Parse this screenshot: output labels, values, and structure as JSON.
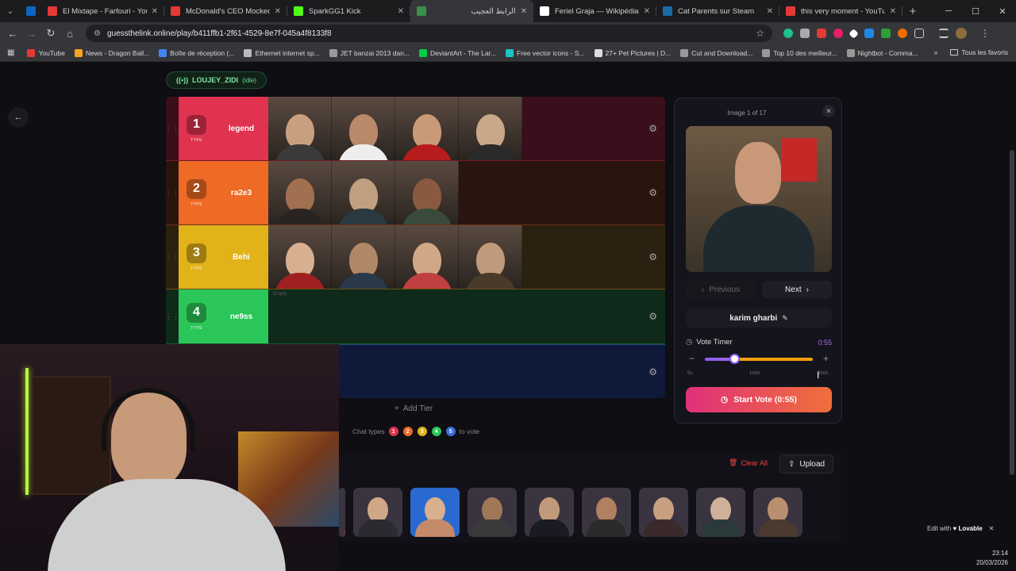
{
  "browser": {
    "tabs": [
      {
        "title": "El Mixtape - Farfouri - YouTube",
        "color": "#e53935"
      },
      {
        "title": "McDonald's CEO Mocked for Bite",
        "color": "#e53935"
      },
      {
        "title": "SparkGG1 Kick",
        "color": "#53fc18"
      },
      {
        "title": "الرابط العجيب",
        "color": "#3a8f4a",
        "active": true
      },
      {
        "title": "Feriel Graja — Wikipédia",
        "color": "#ffffff"
      },
      {
        "title": "Cat Parents sur Steam",
        "color": "#1b6aa5"
      },
      {
        "title": "this very moment - YouTube",
        "color": "#e53935"
      }
    ],
    "url": "guessthelink.online/play/b411ffb1-2f61-4529-8e7f-045a4f8133f8",
    "bookmarks": [
      {
        "label": "YouTube",
        "color": "#e53935"
      },
      {
        "label": "News - Dragon Ball...",
        "color": "#f5a623"
      },
      {
        "label": "Boîte de réception (...",
        "color": "#4285f4"
      },
      {
        "label": "Ethernet internet sp...",
        "color": "#bbbbbb"
      },
      {
        "label": "JET banzai 2013 dan...",
        "color": "#999999"
      },
      {
        "label": "DeviantArt - The Lar...",
        "color": "#05cc47"
      },
      {
        "label": "Free vector icons - S...",
        "color": "#21c4c4"
      },
      {
        "label": "27+ Pet Pictures | D...",
        "color": "#dddddd"
      },
      {
        "label": "Cut and Download...",
        "color": "#999999"
      },
      {
        "label": "Top 10 des meilleur...",
        "color": "#999999"
      },
      {
        "label": "Nightbot - Comma...",
        "color": "#999999"
      }
    ],
    "bookmarks_more": "»",
    "all_bookmarks": "Tous les favoris"
  },
  "app": {
    "user": "LOUJEY_ZIDI",
    "status": "(idle)",
    "type_label": "TYPE",
    "empty_label": "Empty",
    "tiers": [
      {
        "rank": "1",
        "name": "legend",
        "color": "#e0334f",
        "bg": "#3a0e1a",
        "faces": 4
      },
      {
        "rank": "2",
        "name": "ra2e3",
        "color": "#ee6a25",
        "bg": "#2a140e",
        "faces": 3
      },
      {
        "rank": "3",
        "name": "Behi",
        "color": "#e2b21b",
        "bg": "#2a2110",
        "faces": 4
      },
      {
        "rank": "4",
        "name": "ne9ss",
        "color": "#2bc65a",
        "bg": "#0f2a1a",
        "faces": 0
      }
    ],
    "add_tier": "Add Tier",
    "chat_types": "Chat types",
    "chat_dots": [
      {
        "n": "1",
        "color": "#e0334f"
      },
      {
        "n": "2",
        "color": "#ee6a25"
      },
      {
        "n": "3",
        "color": "#e2b21b"
      },
      {
        "n": "4",
        "color": "#2bc65a"
      },
      {
        "n": "5",
        "color": "#3b6fd8"
      }
    ],
    "to_vote": "to vote",
    "clear_all": "Clear All",
    "upload": "Upload"
  },
  "panel": {
    "image_count": "Image 1 of 17",
    "previous": "Previous",
    "next": "Next",
    "name": "karim gharbi",
    "vote_timer_label": "Vote Timer",
    "vote_timer_value": "0:55",
    "timer_fraction": 0.27,
    "ticks": [
      "5s",
      "1min",
      "2min"
    ],
    "start_vote": "Start Vote (0:55)"
  },
  "footer": {
    "edit_with": "Edit with",
    "lovable": "Lovable",
    "time": "23:14",
    "date": "20/03/2026"
  }
}
